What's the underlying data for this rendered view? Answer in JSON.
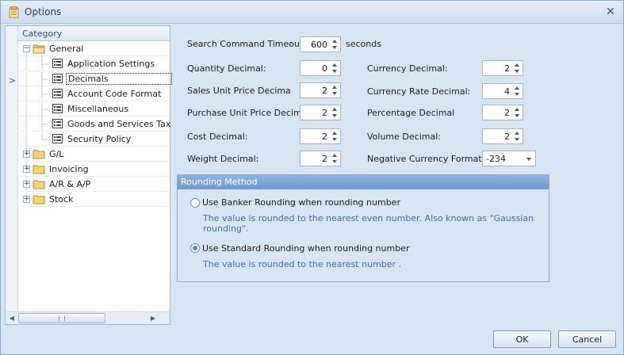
{
  "window": {
    "title": "Options"
  },
  "tree": {
    "header": "Category",
    "general": "General",
    "children": [
      "Application Settings",
      "Decimals",
      "Account Code Format",
      "Miscellaneous",
      "Goods and Services Tax",
      "Security Policy"
    ],
    "gl": "G/L",
    "invoicing": "Invoicing",
    "arap": "A/R & A/P",
    "stock": "Stock"
  },
  "settings": {
    "search_timeout_label": "Search Command Timeout:",
    "search_timeout_value": "600",
    "seconds_label": "seconds",
    "quantity_label": "Quantity Decimal:",
    "quantity_value": "0",
    "currency_label": "Currency Decimal:",
    "currency_value": "2",
    "sales_price_label": "Sales Unit Price Decima",
    "sales_price_value": "2",
    "currency_rate_label": "Currency Rate Decimal:",
    "currency_rate_value": "4",
    "purchase_price_label": "Purchase Unit Price Decima",
    "purchase_price_value": "2",
    "percentage_label": "Percentage Decimal",
    "percentage_value": "2",
    "cost_label": "Cost Decimal:",
    "cost_value": "2",
    "volume_label": "Volume Decimal:",
    "volume_value": "2",
    "weight_label": "Weight Decimal:",
    "weight_value": "2",
    "negative_format_label": "Negative Currency Format",
    "negative_format_value": "-234"
  },
  "rounding": {
    "header": "Rounding Method",
    "banker_label": "Use Banker Rounding when rounding number",
    "banker_desc": "The value is rounded to the nearest even number. Also known as \"Gaussian rounding\".",
    "standard_label": "Use Standard Rounding when rounding number",
    "standard_desc": "The value is rounded to the nearest number ."
  },
  "buttons": {
    "ok_label": "OK",
    "cancel_label": "Cancel"
  },
  "colors": {
    "accent": "#6f98d1",
    "description_text": "#3f6fb4"
  }
}
